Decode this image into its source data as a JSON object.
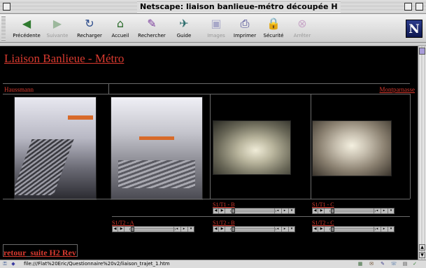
{
  "window": {
    "title": "Netscape: liaison banlieue-métro découpée H"
  },
  "toolbar": {
    "buttons": [
      {
        "label": "Précédente",
        "icon": "back-arrow-icon",
        "enabled": true
      },
      {
        "label": "Suivante",
        "icon": "forward-arrow-icon",
        "enabled": false
      },
      {
        "label": "Recharger",
        "icon": "reload-icon",
        "enabled": true
      },
      {
        "label": "Accueil",
        "icon": "home-icon",
        "enabled": true
      },
      {
        "label": "Rechercher",
        "icon": "search-icon",
        "enabled": true
      },
      {
        "label": "Guide",
        "icon": "guide-icon",
        "enabled": true
      },
      {
        "label": "Images",
        "icon": "images-icon",
        "enabled": false
      },
      {
        "label": "Imprimer",
        "icon": "print-icon",
        "enabled": true
      },
      {
        "label": "Sécurité",
        "icon": "lock-icon",
        "enabled": true
      },
      {
        "label": "Arrêter",
        "icon": "stop-icon",
        "enabled": false
      }
    ],
    "logo": "N"
  },
  "page": {
    "title": "Liaison Banlieue - Métro",
    "left_label": "Haussmann",
    "right_label": "Montparnasse",
    "clips": [
      "S1/T2 - A",
      "S1/T1 - B",
      "S1/T2 - B",
      "S1/T1 - C",
      "S1/T2 - C"
    ],
    "nav": {
      "back": "retour",
      "next": "suite H2 Rev"
    }
  },
  "status": {
    "url": "file:///Flat%20Eric/Questionnaire%20v2/liaison_trajet_1.htm"
  },
  "colors": {
    "link": "#d93a2f",
    "background": "#000000"
  }
}
